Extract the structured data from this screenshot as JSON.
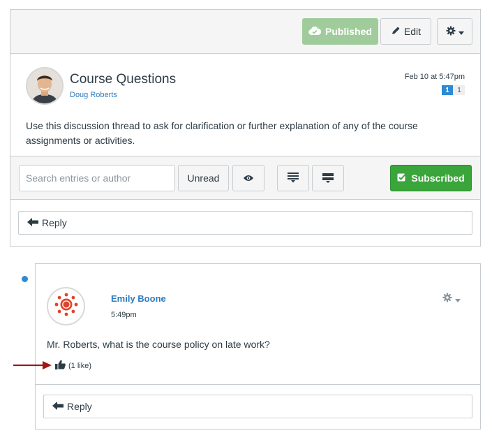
{
  "header": {
    "published_label": "Published",
    "edit_label": "Edit"
  },
  "topic": {
    "title": "Course Questions",
    "author": "Doug Roberts",
    "date": "Feb 10 at 5:47pm",
    "unread_count": "1",
    "total_count": "1",
    "message": "Use this discussion thread to ask for clarification or further explanation of any of the course assignments or activities."
  },
  "toolbar": {
    "search_placeholder": "Search entries or author",
    "unread_label": "Unread",
    "subscribed_label": "Subscribed"
  },
  "reply_label": "Reply",
  "entry": {
    "author": "Emily Boone",
    "time": "5:49pm",
    "message": "Mr. Roberts, what is the course policy on late work?",
    "likes": "(1 like)",
    "reply_label": "Reply"
  },
  "colors": {
    "published": "#a0cc9c",
    "subscribed": "#3aa53a",
    "link": "#2d7bc0",
    "unread": "#2d8ad6",
    "annotation_arrow": "#a31515"
  },
  "icons": [
    "cloud-check-icon",
    "pencil-icon",
    "gear-icon",
    "caret-down-icon",
    "eye-icon",
    "collapse-icon",
    "expand-icon",
    "checkbox-icon",
    "reply-arrow-icon",
    "thumbs-up-icon",
    "canvas-logo-icon",
    "annotation-arrow-icon"
  ]
}
